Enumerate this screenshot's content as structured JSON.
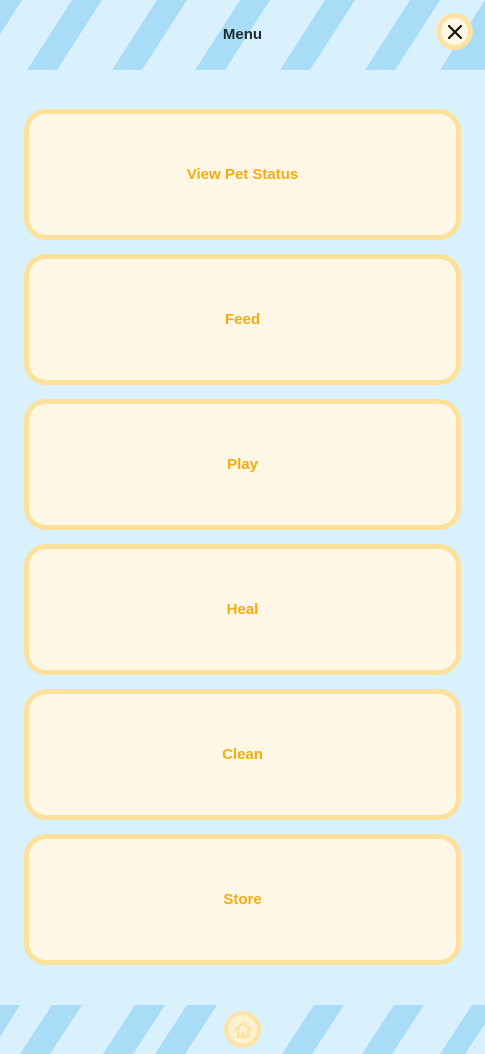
{
  "header": {
    "title": "Menu",
    "close_icon": "close-icon"
  },
  "menu": {
    "items": [
      {
        "label": "View Pet Status"
      },
      {
        "label": "Feed"
      },
      {
        "label": "Play"
      },
      {
        "label": "Heal"
      },
      {
        "label": "Clean"
      },
      {
        "label": "Store"
      }
    ]
  },
  "footer": {
    "home_icon": "home-icon"
  },
  "colors": {
    "background": "#d8f1fc",
    "stripe": "#a9dcf6",
    "button_fill": "#fff7e5",
    "button_border": "#fde09a",
    "button_text": "#f4ad10",
    "title_text": "#1f2a33"
  }
}
